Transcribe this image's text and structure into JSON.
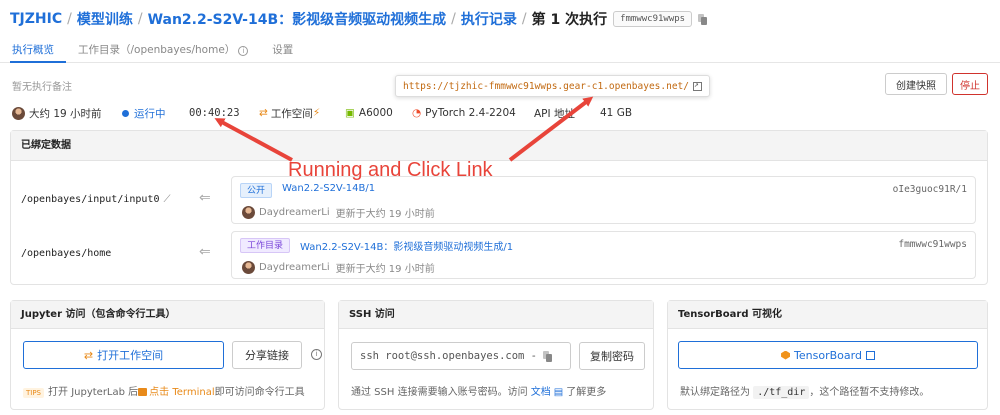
{
  "breadcrumb": {
    "org": "TJZHIC",
    "section": "模型训练",
    "project": "Wan2.2-S2V-14B：影视级音频驱动视频生成",
    "records": "执行记录",
    "current": "第 1 次执行",
    "run_id": "fmmwwc91wwps"
  },
  "tabs": [
    {
      "label": "执行概览",
      "active": true
    },
    {
      "label": "工作目录（/openbayes/home）",
      "active": false
    },
    {
      "label": "设置",
      "active": false
    }
  ],
  "note": "暂无执行备注",
  "url_tooltip": "https://tjzhic-fmmwwc91wwps.gear-c1.openbayes.net/",
  "actions": {
    "snapshot": "创建快照",
    "stop": "停止"
  },
  "status": {
    "created": "大约 19 小时前",
    "state": "运行中",
    "elapsed": "00:40:23",
    "workspace": "工作空间",
    "gpu": "A6000",
    "image": "PyTorch 2.4-2204",
    "api": "API 地址",
    "memory": "41 GB"
  },
  "bound_data": {
    "title": "已绑定数据",
    "mounts": [
      {
        "path": "/openbayes/input/input0",
        "badge": "公开",
        "link": "Wan2.2-S2V-14B/1",
        "id": "oIe3guoc91R/1",
        "user": "DaydreamerLi",
        "updated": "更新于大约 19 小时前"
      },
      {
        "path": "/openbayes/home",
        "badge": "工作目录",
        "link": "Wan2.2-S2V-14B：影视级音频驱动视频生成/1",
        "id": "fmmwwc91wwps",
        "user": "DaydreamerLi",
        "updated": "更新于大约 19 小时前"
      }
    ]
  },
  "jupyter": {
    "title": "Jupyter 访问（包含命令行工具）",
    "open_btn": "打开工作空间",
    "share_btn": "分享链接",
    "tips_tag": "TIPS",
    "tip_a": "打开 JupyterLab 后",
    "tip_b": "点击 Terminal",
    "tip_c": "即可访问命令行工具"
  },
  "ssh": {
    "title": "SSH 访问",
    "command": "ssh root@ssh.openbayes.com -",
    "copy_btn": "复制密码",
    "foot_a": "通过 SSH 连接需要输入账号密码。访问",
    "foot_link": "文档",
    "foot_b": "了解更多"
  },
  "tensorboard": {
    "title": "TensorBoard 可视化",
    "btn": "TensorBoard",
    "foot_a": "默认绑定路径为",
    "foot_code": "./tf_dir",
    "foot_b": "，这个路径暂不支持修改。"
  },
  "annotation": "Running and Click Link",
  "colors": {
    "accent": "#1f6fd8",
    "danger": "#d0332d",
    "annotation": "#e8443a",
    "warning": "#e88a1a"
  }
}
